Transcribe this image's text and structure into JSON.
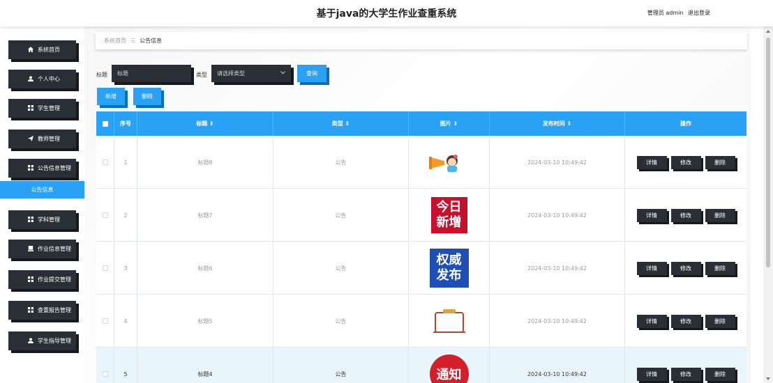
{
  "header": {
    "title": "基于java的大学生作业查重系统",
    "user_label": "管理员 admin",
    "logout_label": "退出登录"
  },
  "sidebar": {
    "items": [
      {
        "label": "系统首页",
        "icon": "home-icon"
      },
      {
        "label": "个人中心",
        "icon": "user-icon"
      },
      {
        "label": "学生管理",
        "icon": "grid-icon"
      },
      {
        "label": "教师管理",
        "icon": "send-icon"
      },
      {
        "label": "公告信息管理",
        "icon": "grid-icon"
      },
      {
        "label": "学科管理",
        "icon": "grid-icon"
      },
      {
        "label": "作业信息管理",
        "icon": "document-icon"
      },
      {
        "label": "作业提交管理",
        "icon": "grid-icon"
      },
      {
        "label": "查重报告管理",
        "icon": "grid-icon"
      },
      {
        "label": "学生指导管理",
        "icon": "user-icon"
      }
    ],
    "active_subitem": "公告信息"
  },
  "breadcrumb": {
    "home": "系统首页",
    "separator": "☰",
    "current": "公告信息"
  },
  "search": {
    "title_label": "标题",
    "title_placeholder": "标题",
    "type_label": "类型",
    "type_placeholder": "请选择类型",
    "query_button": "查询"
  },
  "actions": {
    "add_button": "新增",
    "delete_button": "删除"
  },
  "table": {
    "columns": [
      "序号",
      "标题 ⇕",
      "类型 ⇕",
      "图片 ⇕",
      "发布时间 ⇕",
      "操作"
    ],
    "row_actions": [
      "详情",
      "修改",
      "删除"
    ],
    "rows": [
      {
        "index": "1",
        "title": "标题8",
        "type": "公告",
        "image": "megaphone-girl-image",
        "time": "2024-03-10 10:49:42"
      },
      {
        "index": "2",
        "title": "标题7",
        "type": "公告",
        "image": "jinri-xinzeng-image",
        "image_text": "今日新增",
        "time": "2024-03-10 10:49:42"
      },
      {
        "index": "3",
        "title": "标题6",
        "type": "公告",
        "image": "quanwei-fabu-image",
        "image_text": "权威发布",
        "time": "2024-03-10 10:49:42"
      },
      {
        "index": "4",
        "title": "标题5",
        "type": "公告",
        "image": "notice-board-image",
        "time": "2024-03-10 10:49:42"
      },
      {
        "index": "5",
        "title": "标题4",
        "type": "公告",
        "image": "tongzhi-image",
        "image_text": "通知",
        "time": "2024-03-10 10:49:42"
      }
    ]
  },
  "colors": {
    "accent": "#29a2f5",
    "dark_button": "#2a2f35",
    "highlight_row": "#e9f5fd"
  }
}
